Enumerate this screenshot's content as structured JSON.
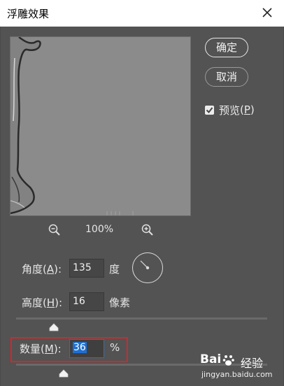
{
  "window": {
    "title": "浮雕效果"
  },
  "buttons": {
    "ok": "确定",
    "cancel": "取消"
  },
  "preview_checkbox": {
    "label": "预览",
    "accel": "P",
    "checked": true
  },
  "zoom": {
    "level": "100%"
  },
  "angle": {
    "label": "角度",
    "accel": "A",
    "value": "135",
    "unit": "度"
  },
  "height": {
    "label": "高度",
    "accel": "H",
    "value": "16",
    "unit": "像素"
  },
  "amount": {
    "label": "数量",
    "accel": "M",
    "value": "36",
    "unit": "%"
  },
  "watermark": {
    "brand": "Bai",
    "brand_cn": "经验",
    "url": "jingyan.baidu.com"
  },
  "colors": {
    "background": "#535353",
    "accent": "#1f6fd1",
    "highlight_box": "#d9242c"
  }
}
